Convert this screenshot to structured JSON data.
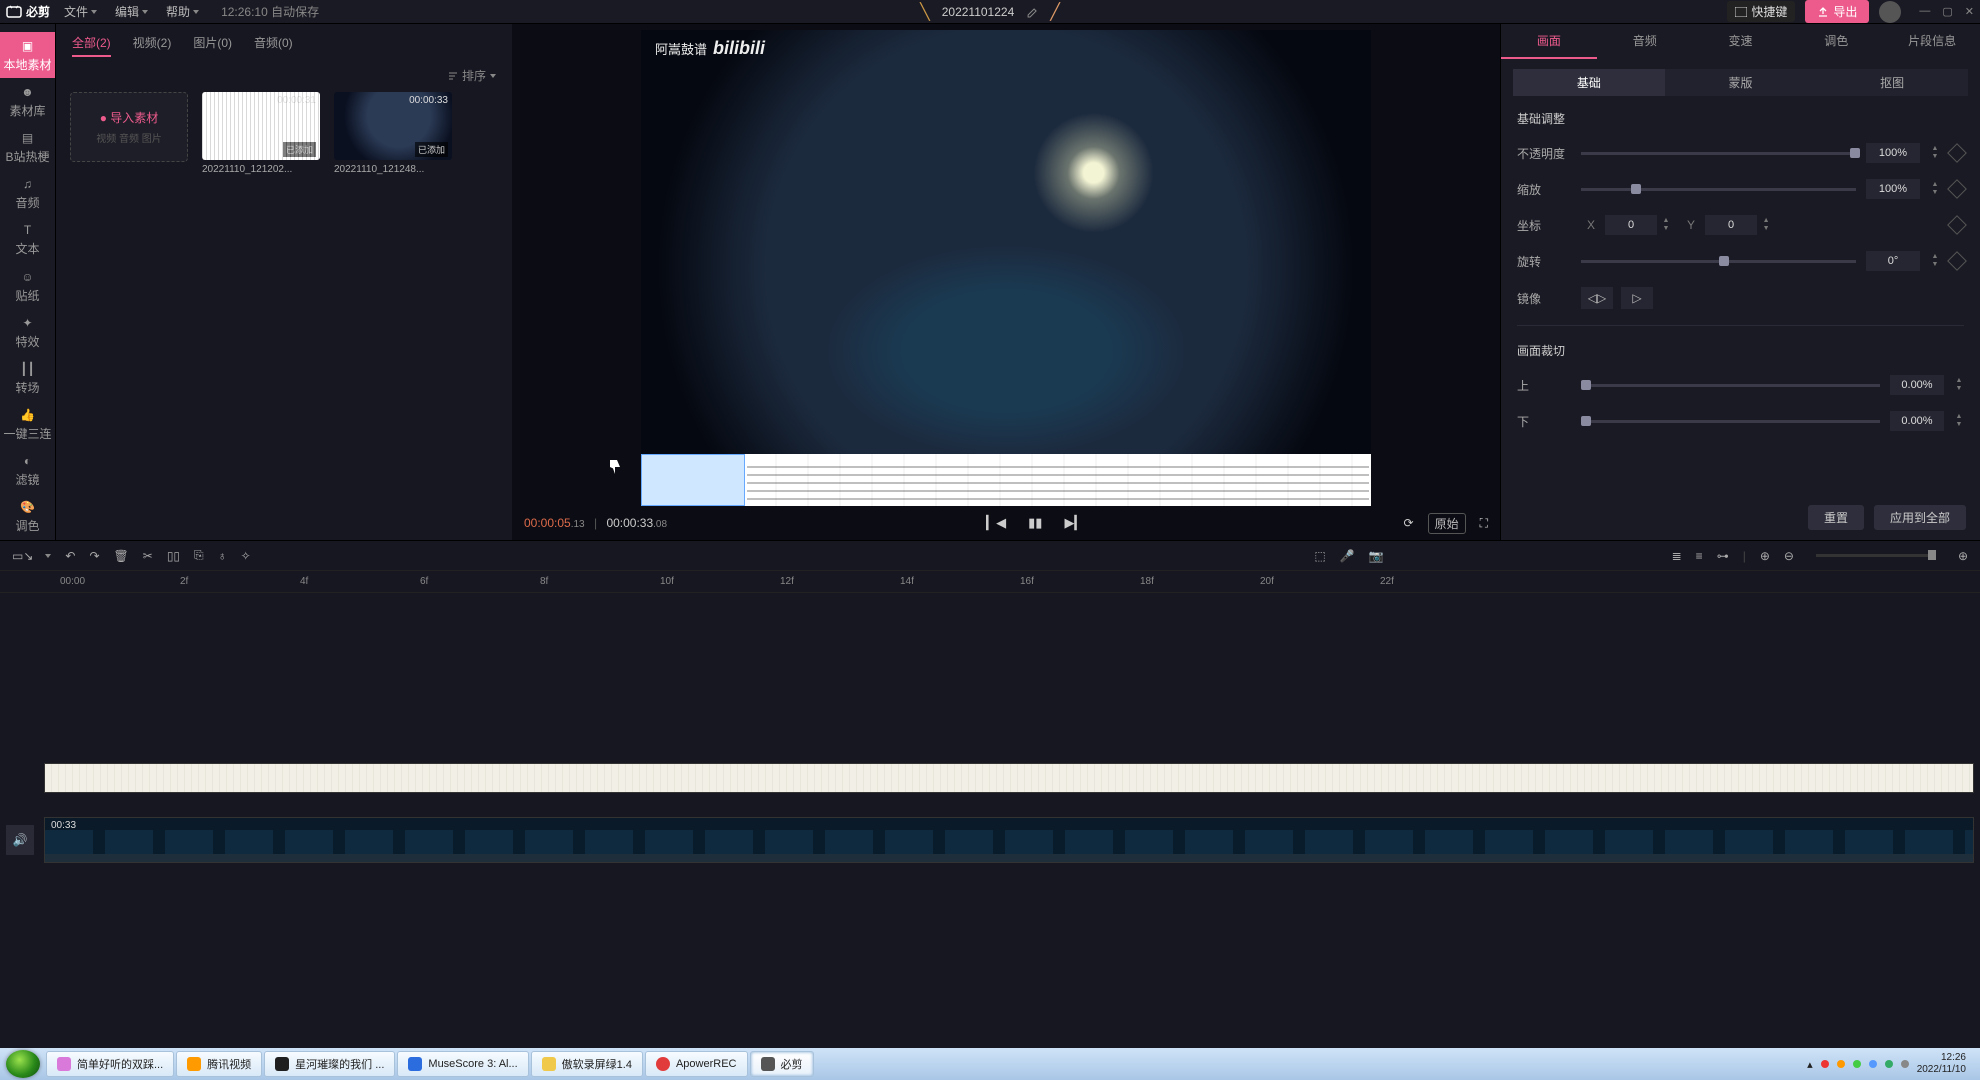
{
  "title": {
    "app": "必剪",
    "project": "20221101224",
    "autosave": "12:26:10 自动保存"
  },
  "menu": {
    "file": "文件",
    "edit": "编辑",
    "help": "帮助"
  },
  "header": {
    "shortcut": "快捷键",
    "export": "导出"
  },
  "leftnav": [
    "本地素材",
    "素材库",
    "B站热梗",
    "音频",
    "文本",
    "贴纸",
    "特效",
    "转场",
    "一键三连",
    "滤镜",
    "调色"
  ],
  "media_tabs": {
    "all": "全部(2)",
    "video": "视频(2)",
    "image": "图片(0)",
    "audio": "音频(0)"
  },
  "sort": "排序",
  "import": {
    "label": "导入素材",
    "sub": "视频 音频 图片"
  },
  "clips": [
    {
      "dur": "00:00:31",
      "badge": "已添加",
      "name": "20221110_121202..."
    },
    {
      "dur": "00:00:33",
      "badge": "已添加",
      "name": "20221110_121248..."
    }
  ],
  "watermark": "阿嵩鼓谱",
  "preview": {
    "cur": "00:00:05",
    "curf": ".13",
    "tot": "00:00:33",
    "totf": ".08",
    "orig": "原始"
  },
  "inspector": {
    "tabs": [
      "画面",
      "音频",
      "变速",
      "调色",
      "片段信息"
    ],
    "subtabs": [
      "基础",
      "蒙版",
      "抠图"
    ],
    "section_basic": "基础调整",
    "opacity": {
      "label": "不透明度",
      "value": "100%"
    },
    "scale": {
      "label": "缩放",
      "value": "100%"
    },
    "coord": {
      "label": "坐标",
      "x": "0",
      "y": "0"
    },
    "rotate": {
      "label": "旋转",
      "value": "0°"
    },
    "mirror": "镜像",
    "section_crop": "画面裁切",
    "top": {
      "label": "上",
      "value": "0.00%"
    },
    "bottom": {
      "label": "下",
      "value": "0.00%"
    },
    "reset": "重置",
    "applyall": "应用到全部"
  },
  "ruler": [
    "00:00",
    "2f",
    "4f",
    "6f",
    "8f",
    "10f",
    "12f",
    "14f",
    "16f",
    "18f",
    "20f",
    "22f"
  ],
  "track_video_dur": "00:33",
  "taskbar": {
    "items": [
      {
        "label": "简单好听的双踩...",
        "color": "#d97adb"
      },
      {
        "label": "腾讯视频",
        "color": "#ff9a00"
      },
      {
        "label": "星河璀璨的我们 ...",
        "color": "#1f1f1f"
      },
      {
        "label": "MuseScore 3: Al...",
        "color": "#2b6cdf"
      },
      {
        "label": "傲软录屏绿1.4",
        "color": "#f0c94a"
      },
      {
        "label": "ApowerREC",
        "color": "#e23b3b"
      },
      {
        "label": "必剪",
        "color": "#555"
      }
    ],
    "time": "12:26",
    "date": "2022/11/10"
  }
}
